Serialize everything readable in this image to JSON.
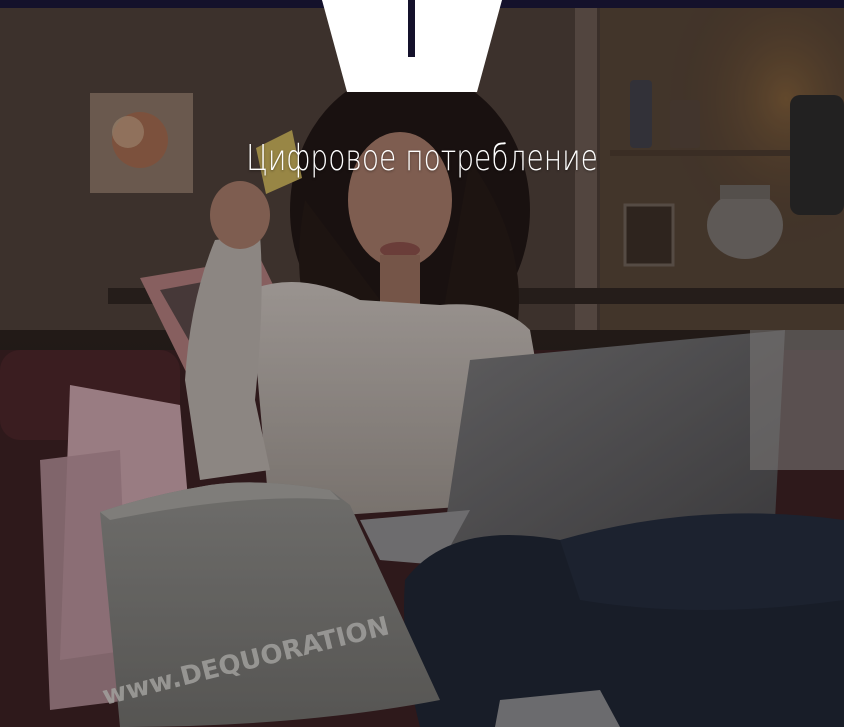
{
  "hero": {
    "title": "Цифровое потребление",
    "bag_text": "www.DEQUORATION"
  },
  "icons": {
    "badge": "hexagon-badge-icon"
  },
  "colors": {
    "top_bar": "#14112b",
    "badge_fill": "#ffffff",
    "badge_mark": "#14112b",
    "title_text": "#ffffff"
  }
}
